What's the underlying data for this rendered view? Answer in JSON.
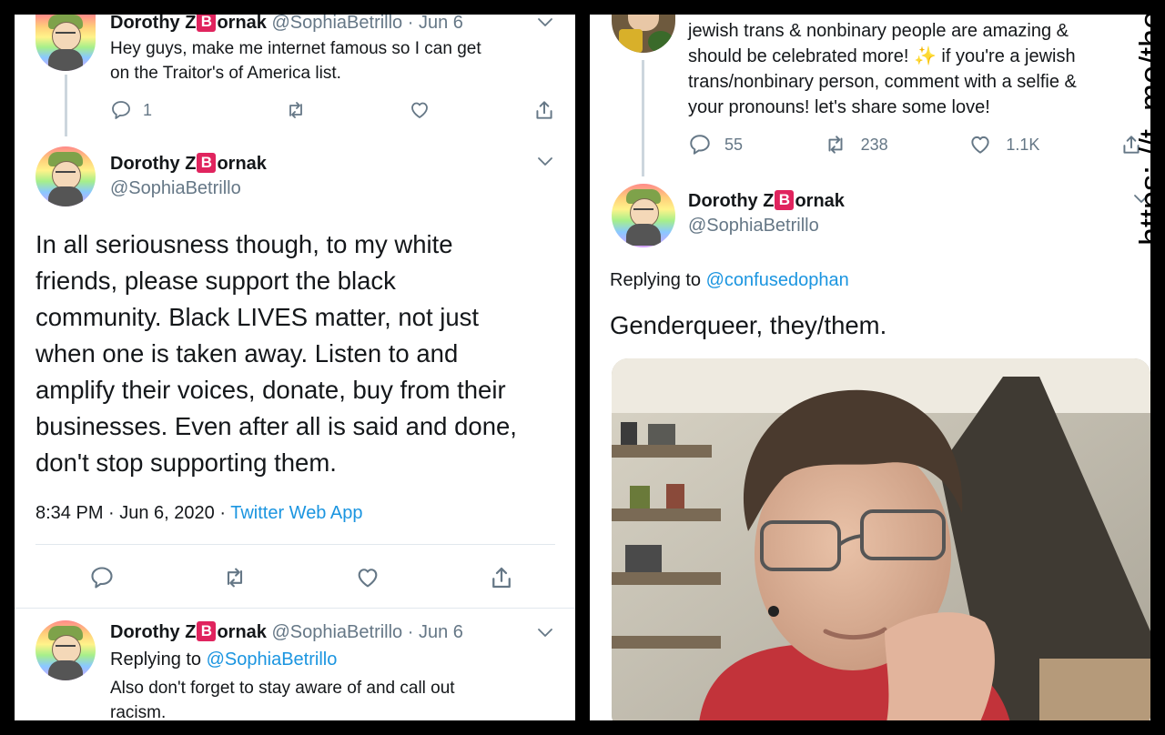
{
  "left_panel": {
    "tweet1": {
      "display_name_before": "Dorothy Z",
      "display_name_badge": "B",
      "display_name_after": "ornak",
      "handle": "@SophiaBetrillo",
      "separator": "·",
      "date": "Jun 6",
      "text_line1": "Hey guys, make me internet famous so I can get",
      "text_line2": "on the Traitor's of America list.",
      "reply_count": "1"
    },
    "tweet2": {
      "display_name_before": "Dorothy Z",
      "display_name_badge": "B",
      "display_name_after": "ornak",
      "handle": "@SophiaBetrillo",
      "body_lines": [
        "In all seriousness though, to my white",
        "friends, please support the black",
        "community. Black LIVES matter, not just",
        "when one is taken away. Listen to and",
        "amplify their voices, donate, buy from their",
        "businesses. Even after all is said and done,",
        "don't stop supporting them."
      ],
      "timestamp": "8:34 PM · Jun 6, 2020 ·",
      "source": "Twitter Web App"
    },
    "tweet3": {
      "display_name_before": "Dorothy Z",
      "display_name_badge": "B",
      "display_name_after": "ornak",
      "handle": "@SophiaBetrillo",
      "separator": "·",
      "date": "Jun 6",
      "replying_prefix": "Replying to",
      "replying_handle": "@SophiaBetrillo",
      "text_line1": "Also don't forget to stay aware of and call out",
      "text_line2": "racism."
    }
  },
  "right_panel": {
    "tweet1": {
      "text_lines": [
        "jewish trans & nonbinary people are amazing &",
        "should be celebrated more!",
        "if you're a jewish",
        "trans/nonbinary person, comment with a selfie &",
        "your pronouns! let's share some love!"
      ],
      "sparkle": "✨",
      "reply_count": "55",
      "retweet_count": "238",
      "like_count": "1.1K"
    },
    "tweet2": {
      "display_name_before": "Dorothy Z",
      "display_name_badge": "B",
      "display_name_after": "ornak",
      "handle": "@SophiaBetrillo",
      "replying_prefix": "Replying to",
      "replying_handle": "@confusedophan",
      "body": "Genderqueer, they/them."
    }
  },
  "watermark": "https: //t. me/theenoticer",
  "colors": {
    "link_blue": "#1b95e0",
    "muted_grey": "#657786",
    "badge_red": "#e0245e",
    "background": "#000000"
  },
  "icons": [
    "reply-icon",
    "retweet-icon",
    "like-icon",
    "share-icon",
    "chevron-down-icon",
    "sparkle-icon"
  ]
}
